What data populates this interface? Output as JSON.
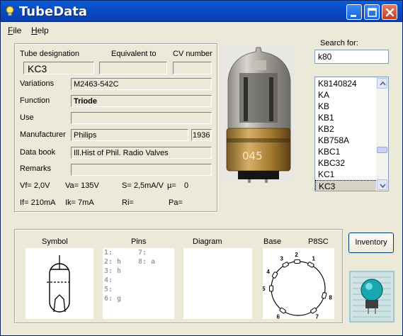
{
  "window": {
    "title": "TubeData"
  },
  "menu": {
    "file": "F",
    "file_rest": "ile",
    "help": "H",
    "help_rest": "elp"
  },
  "details": {
    "tube_designation_label": "Tube designation",
    "equivalent_label": "Equivalent to",
    "cv_label": "CV number",
    "tube_designation": "KC3",
    "equivalent": "",
    "cv_number": "",
    "variations_label": "Variations",
    "variations": "M2463-542C",
    "function_label": "Function",
    "function": "Triode",
    "use_label": "Use",
    "use": "",
    "manufacturer_label": "Manufacturer",
    "manufacturer": "Philips",
    "year": "1936",
    "data_book_label": "Data book",
    "data_book": "Ill.Hist of Phil. Radio Valves",
    "remarks_label": "Remarks",
    "remarks": "",
    "vf": "Vf= 2,0V",
    "va": "Va= 135V",
    "s": "S= 2,5mA/V",
    "mu": "µ=",
    "mu_value": "0",
    "if": "If= 210mA",
    "ik": "Ik= 7mA",
    "ri": "Ri=",
    "pa": "Pa="
  },
  "search": {
    "label": "Search for:",
    "value": "k80",
    "results": [
      "K8140824",
      "KA",
      "KB",
      "KB1",
      "KB2",
      "KB758A",
      "KBC1",
      "KBC32",
      "KC1",
      "KC3"
    ],
    "selected": "KC3"
  },
  "bottom": {
    "symbol_label": "Symbol",
    "pins_label": "Pins",
    "diagram_label": "Diagram",
    "base_label": "Base",
    "base_type": "P8SC",
    "pins_col1": [
      "1:",
      "2: h",
      "3: h",
      "4:",
      "5:",
      "6: g"
    ],
    "pins_col2": [
      "7:",
      "8: a"
    ],
    "base_pin_numbers": [
      "1",
      "2",
      "3",
      "4",
      "5",
      "6",
      "7",
      "8"
    ]
  },
  "inventory_button": "Inventory",
  "photo_text": "045"
}
